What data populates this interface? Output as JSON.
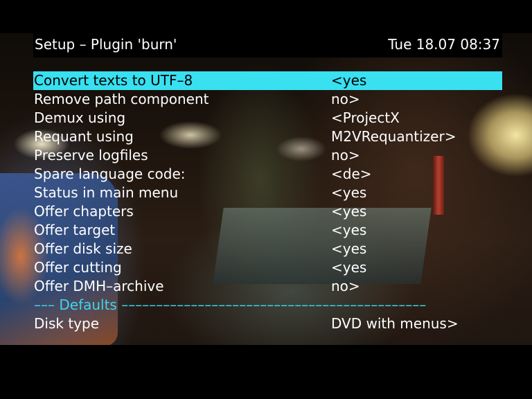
{
  "header": {
    "title": "Setup – Plugin 'burn'",
    "datetime": "Tue 18.07 08:37"
  },
  "menu": {
    "items": [
      {
        "label": "Convert texts to UTF–8",
        "value": "<yes",
        "selected": true
      },
      {
        "label": "Remove path component",
        "value": "no>"
      },
      {
        "label": "Demux using",
        "value": "<ProjectX"
      },
      {
        "label": "Requant using",
        "value": "M2VRequantizer>"
      },
      {
        "label": "Preserve logfiles",
        "value": "no>"
      },
      {
        "label": "Spare language code:",
        "value": "<de>"
      },
      {
        "label": "Status in main menu",
        "value": "<yes"
      },
      {
        "label": "Offer chapters",
        "value": "<yes"
      },
      {
        "label": "Offer target",
        "value": "<yes"
      },
      {
        "label": "Offer disk size",
        "value": "<yes"
      },
      {
        "label": "Offer cutting",
        "value": "<yes"
      },
      {
        "label": "Offer DMH–archive",
        "value": "no>"
      }
    ],
    "separator": "––– Defaults ––––––––––––––––––––––––––––––––––––––––––––",
    "defaults": [
      {
        "label": "Disk type",
        "value": "DVD with menus>"
      }
    ]
  },
  "colors": {
    "highlight": "#38e0f0",
    "separator": "#38d8f0",
    "text": "#ffffff",
    "osd_background": "#000000"
  }
}
